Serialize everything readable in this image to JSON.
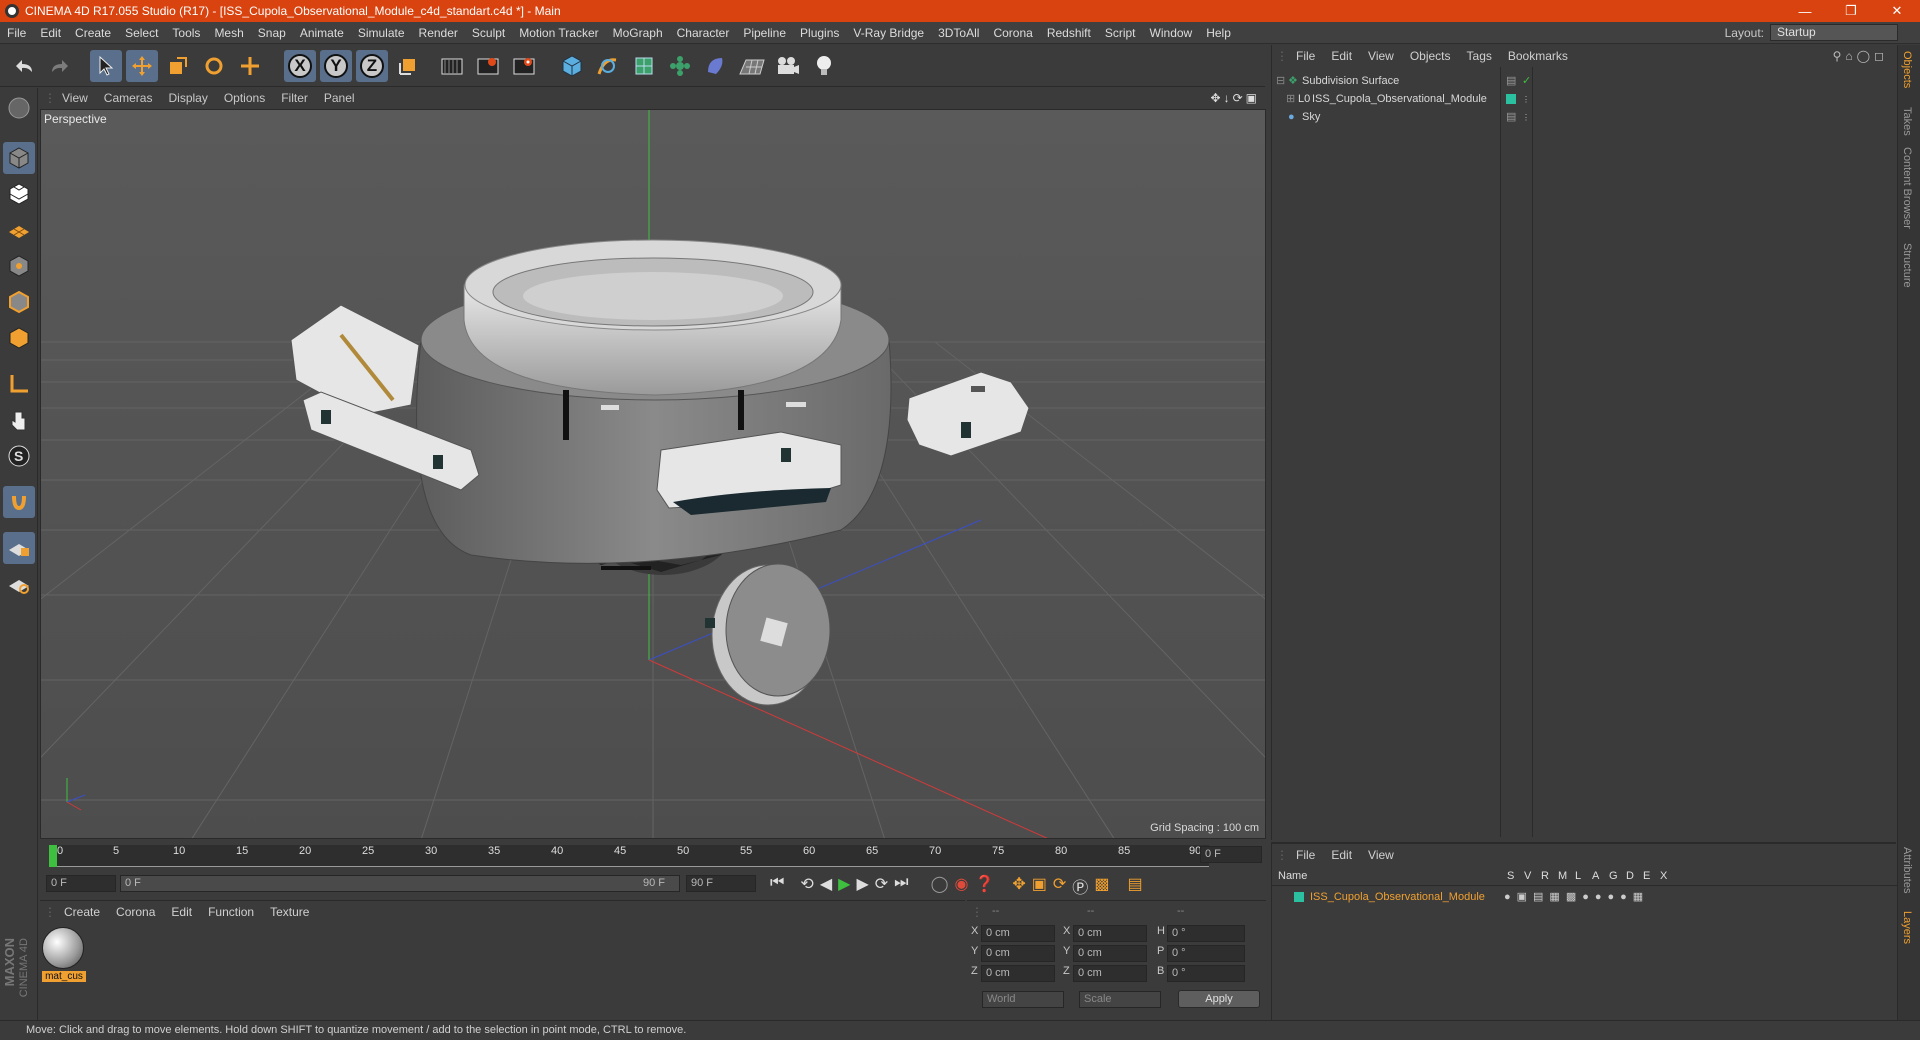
{
  "window": {
    "title": "CINEMA 4D R17.055 Studio (R17) - [ISS_Cupola_Observational_Module_c4d_standart.c4d *] - Main"
  },
  "menu": [
    "File",
    "Edit",
    "Create",
    "Select",
    "Tools",
    "Mesh",
    "Snap",
    "Animate",
    "Simulate",
    "Render",
    "Sculpt",
    "Motion Tracker",
    "MoGraph",
    "Character",
    "Pipeline",
    "Plugins",
    "V-Ray Bridge",
    "3DToAll",
    "Corona",
    "Redshift",
    "Script",
    "Window",
    "Help"
  ],
  "layout": {
    "label": "Layout:",
    "value": "Startup"
  },
  "toolbar": {
    "x": "X",
    "y": "Y",
    "z": "Z"
  },
  "viewport": {
    "menu": [
      "View",
      "Cameras",
      "Display",
      "Options",
      "Filter",
      "Panel"
    ],
    "label": "Perspective",
    "grid_spacing": "Grid Spacing : 100 cm"
  },
  "timeline": {
    "ticks": [
      "0",
      "5",
      "10",
      "15",
      "20",
      "25",
      "30",
      "35",
      "40",
      "45",
      "50",
      "55",
      "60",
      "65",
      "70",
      "75",
      "80",
      "85",
      "90"
    ],
    "current_frame": "0 F",
    "start": "0 F",
    "slider_start": "0 F",
    "slider_end": "90 F",
    "end": "90 F"
  },
  "materials": {
    "menu": [
      "Create",
      "Corona",
      "Edit",
      "Function",
      "Texture"
    ],
    "items": [
      {
        "name": "mat_cus"
      }
    ]
  },
  "coords": {
    "header": [
      "--",
      "--",
      "--"
    ],
    "rows": [
      {
        "a": "X",
        "av": "0 cm",
        "b": "X",
        "bv": "0 cm",
        "c": "H",
        "cv": "0 °"
      },
      {
        "a": "Y",
        "av": "0 cm",
        "b": "Y",
        "bv": "0 cm",
        "c": "P",
        "cv": "0 °"
      },
      {
        "a": "Z",
        "av": "0 cm",
        "b": "Z",
        "bv": "0 cm",
        "c": "B",
        "cv": "0 °"
      }
    ],
    "world": "World",
    "scale": "Scale",
    "apply": "Apply"
  },
  "objects_panel": {
    "menu": [
      "File",
      "Edit",
      "View",
      "Objects",
      "Tags",
      "Bookmarks"
    ],
    "items": [
      {
        "name": "Subdivision Surface"
      },
      {
        "name": "ISS_Cupola_Observational_Module"
      },
      {
        "name": "Sky"
      }
    ]
  },
  "attributes_panel": {
    "menu": [
      "File",
      "Edit",
      "View"
    ],
    "columns": [
      "Name",
      "S",
      "V",
      "R",
      "M",
      "L",
      "A",
      "G",
      "D",
      "E",
      "X"
    ],
    "row": "ISS_Cupola_Observational_Module"
  },
  "side_tabs": [
    "Objects",
    "Takes",
    "Content Browser",
    "Structure"
  ],
  "side_tabs_bottom": [
    "Attributes",
    "Layers"
  ],
  "brand": {
    "line1": "MAXON",
    "line2": "CINEMA 4D"
  },
  "status": "Move: Click and drag to move elements. Hold down SHIFT to quantize movement / add to the selection in point mode, CTRL to remove.",
  "colors": {
    "title": "#d8430f",
    "accent": "#5a6f8c",
    "highlight": "#f0a030"
  }
}
